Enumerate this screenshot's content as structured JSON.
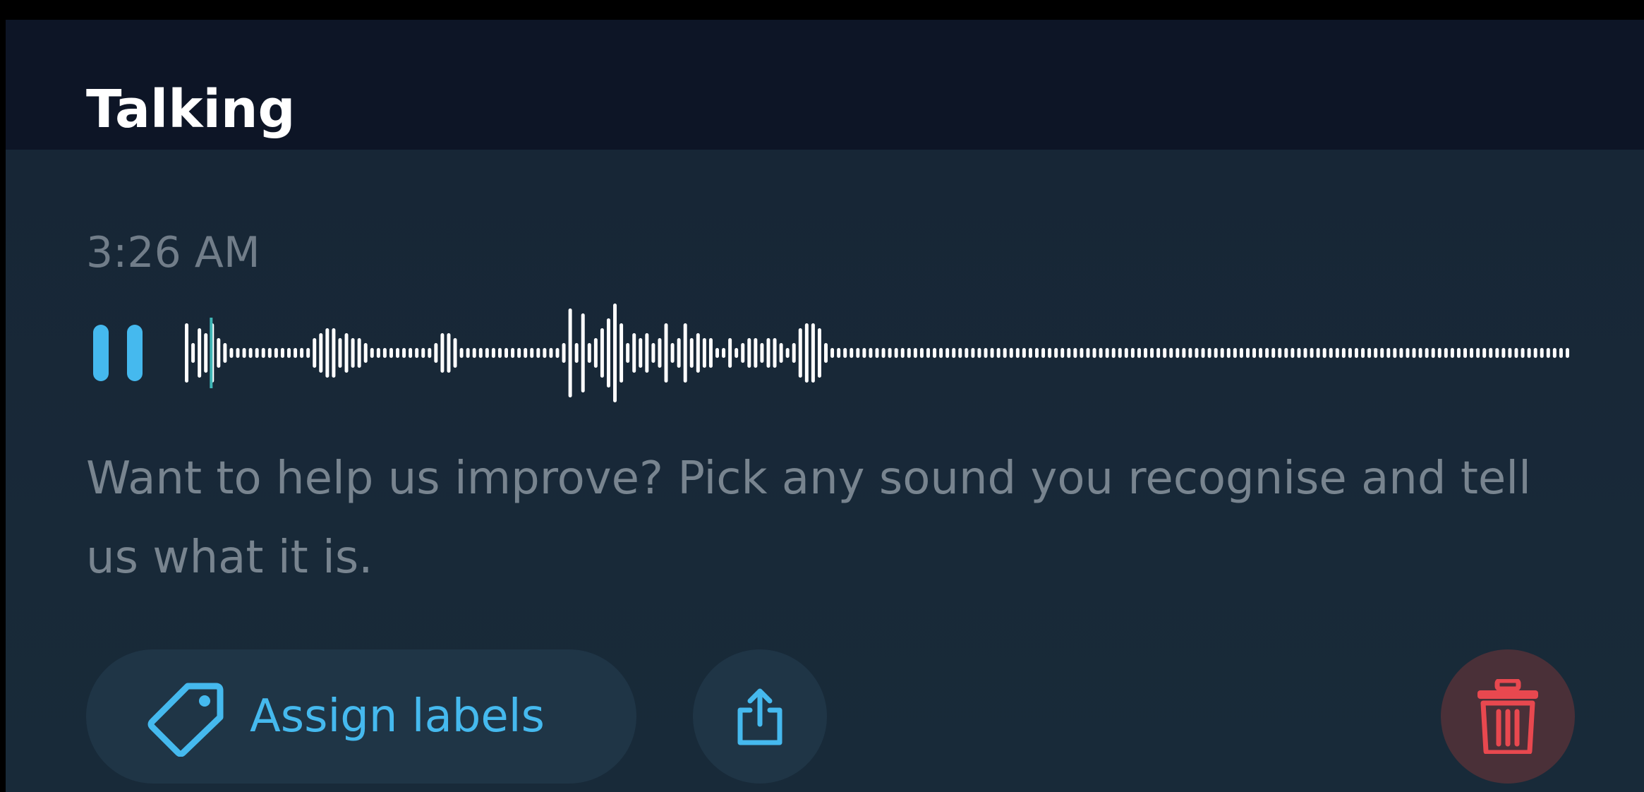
{
  "header": {
    "title": "Talking"
  },
  "recording": {
    "timestamp": "3:26 AM",
    "state": "playing",
    "progress": 0.02,
    "waveform_levels": [
      0.6,
      0.2,
      0.5,
      0.4,
      0.6,
      0.3,
      0.2,
      0.1,
      0.1,
      0.1,
      0.1,
      0.1,
      0.1,
      0.1,
      0.1,
      0.1,
      0.1,
      0.1,
      0.1,
      0.1,
      0.3,
      0.4,
      0.5,
      0.5,
      0.3,
      0.4,
      0.3,
      0.3,
      0.2,
      0.1,
      0.1,
      0.1,
      0.1,
      0.1,
      0.1,
      0.1,
      0.1,
      0.1,
      0.1,
      0.2,
      0.4,
      0.4,
      0.3,
      0.1,
      0.1,
      0.1,
      0.1,
      0.1,
      0.1,
      0.1,
      0.1,
      0.1,
      0.1,
      0.1,
      0.1,
      0.1,
      0.1,
      0.1,
      0.1,
      0.2,
      0.9,
      0.2,
      0.8,
      0.2,
      0.3,
      0.5,
      0.7,
      1.0,
      0.6,
      0.2,
      0.4,
      0.3,
      0.4,
      0.2,
      0.3,
      0.6,
      0.2,
      0.3,
      0.6,
      0.3,
      0.4,
      0.3,
      0.3,
      0.1,
      0.1,
      0.3,
      0.1,
      0.2,
      0.3,
      0.3,
      0.2,
      0.3,
      0.3,
      0.2,
      0.1,
      0.2,
      0.5,
      0.6,
      0.6,
      0.5,
      0.2,
      0.1,
      0.1,
      0.1,
      0.1,
      0.1,
      0.1,
      0.1,
      0.1,
      0.1,
      0.1,
      0.1,
      0.1,
      0.1,
      0.1,
      0.1,
      0.1,
      0.1,
      0.1,
      0.1,
      0.1,
      0.1,
      0.1,
      0.1,
      0.1,
      0.1,
      0.1,
      0.1,
      0.1,
      0.1,
      0.1,
      0.1,
      0.1,
      0.1,
      0.1,
      0.1,
      0.1,
      0.1,
      0.1,
      0.1,
      0.1,
      0.1,
      0.1,
      0.1,
      0.1,
      0.1,
      0.1,
      0.1,
      0.1,
      0.1,
      0.1,
      0.1,
      0.1,
      0.1,
      0.1,
      0.1,
      0.1,
      0.1,
      0.1,
      0.1,
      0.1,
      0.1,
      0.1,
      0.1,
      0.1,
      0.1,
      0.1,
      0.1,
      0.1,
      0.1,
      0.1,
      0.1,
      0.1,
      0.1,
      0.1,
      0.1,
      0.1,
      0.1,
      0.1,
      0.1,
      0.1,
      0.1,
      0.1,
      0.1,
      0.1,
      0.1,
      0.1,
      0.1,
      0.1,
      0.1,
      0.1,
      0.1,
      0.1,
      0.1,
      0.1,
      0.1,
      0.1,
      0.1,
      0.1,
      0.1,
      0.1,
      0.1,
      0.1,
      0.1,
      0.1,
      0.1,
      0.1,
      0.1,
      0.1,
      0.1,
      0.1,
      0.1,
      0.1,
      0.1,
      0.1,
      0.1,
      0.1
    ]
  },
  "message": {
    "text": "Want to help us improve? Pick any sound you recognise and tell us what it is."
  },
  "actions": {
    "assign_labels": "Assign labels",
    "tag_icon": "tag-icon",
    "share_icon": "share-icon",
    "delete_icon": "trash-icon"
  },
  "colors": {
    "accent": "#45b9ee",
    "delete": "#e8484f",
    "waveform": "#ffffff",
    "playhead": "#3fb6b6"
  }
}
